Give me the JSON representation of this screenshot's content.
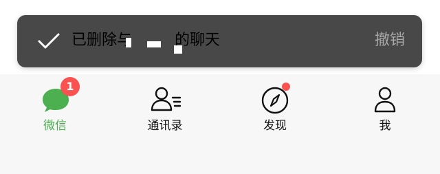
{
  "toast": {
    "message": "已删除与",
    "message_tail": "的聊天",
    "undo_label": "撤销"
  },
  "tabbar": {
    "items": [
      {
        "label": "微信",
        "badge": "1",
        "active": true,
        "icon": "chat-bubble-icon"
      },
      {
        "label": "通讯录",
        "active": false,
        "icon": "contacts-icon"
      },
      {
        "label": "发现",
        "active": false,
        "icon": "compass-icon"
      },
      {
        "label": "我",
        "active": false,
        "icon": "me-icon"
      }
    ]
  },
  "colors": {
    "toast_bg": "#484848",
    "accent_green": "#4caf50",
    "badge_red": "#fa5151"
  }
}
